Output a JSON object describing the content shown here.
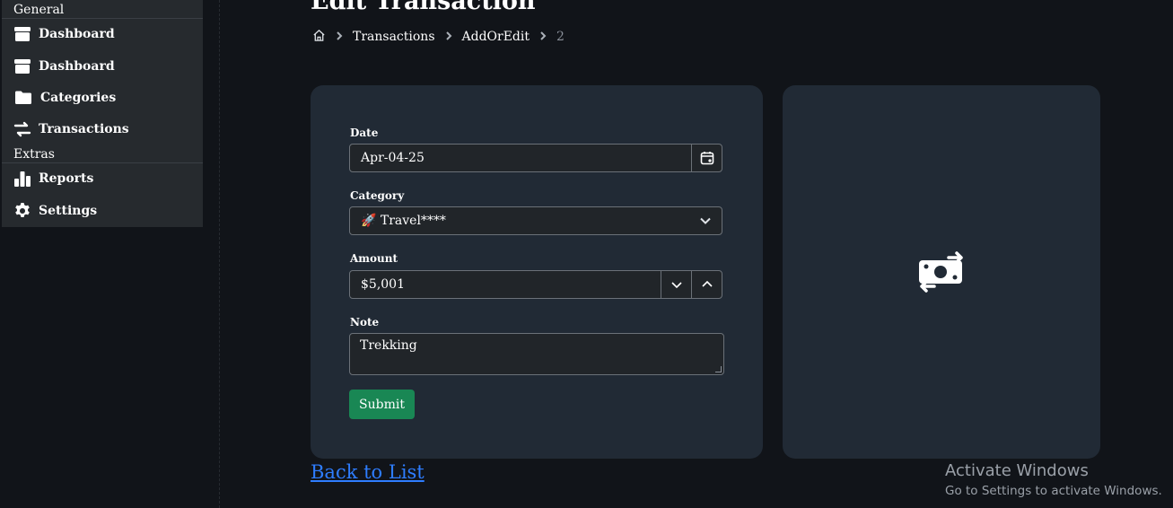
{
  "page": {
    "title": "Edit Transaction"
  },
  "sidebar": {
    "sections": [
      {
        "header": "General"
      },
      {
        "header": "Extras"
      }
    ],
    "items": [
      {
        "label": "Dashboard",
        "icon": "box-icon"
      },
      {
        "label": "Dashboard",
        "icon": "box-icon"
      },
      {
        "label": "Categories",
        "icon": "folder-icon"
      },
      {
        "label": "Transactions",
        "icon": "transfer-icon"
      },
      {
        "label": "Reports",
        "icon": "bar-chart-icon"
      },
      {
        "label": "Settings",
        "icon": "gear-icon"
      }
    ]
  },
  "breadcrumb": {
    "home_icon": "home-icon",
    "items": [
      "Transactions",
      "AddOrEdit",
      "2"
    ]
  },
  "form": {
    "date": {
      "label": "Date",
      "value": "Apr-04-25"
    },
    "category": {
      "label": "Category",
      "value": "🚀 Travel****"
    },
    "amount": {
      "label": "Amount",
      "value": "$5,001"
    },
    "note": {
      "label": "Note",
      "value": "Trekking"
    },
    "submit_label": "Submit"
  },
  "side_panel": {
    "icon": "money-transfer-icon"
  },
  "links": {
    "back_to_list": "Back to List"
  },
  "watermark": {
    "line1": "Activate Windows",
    "line2": "Go to Settings to activate Windows."
  },
  "colors": {
    "background": "#111419",
    "sidebar": "#262a2e",
    "card": "#212a35",
    "submit": "#198754",
    "link": "#2e7dff"
  }
}
